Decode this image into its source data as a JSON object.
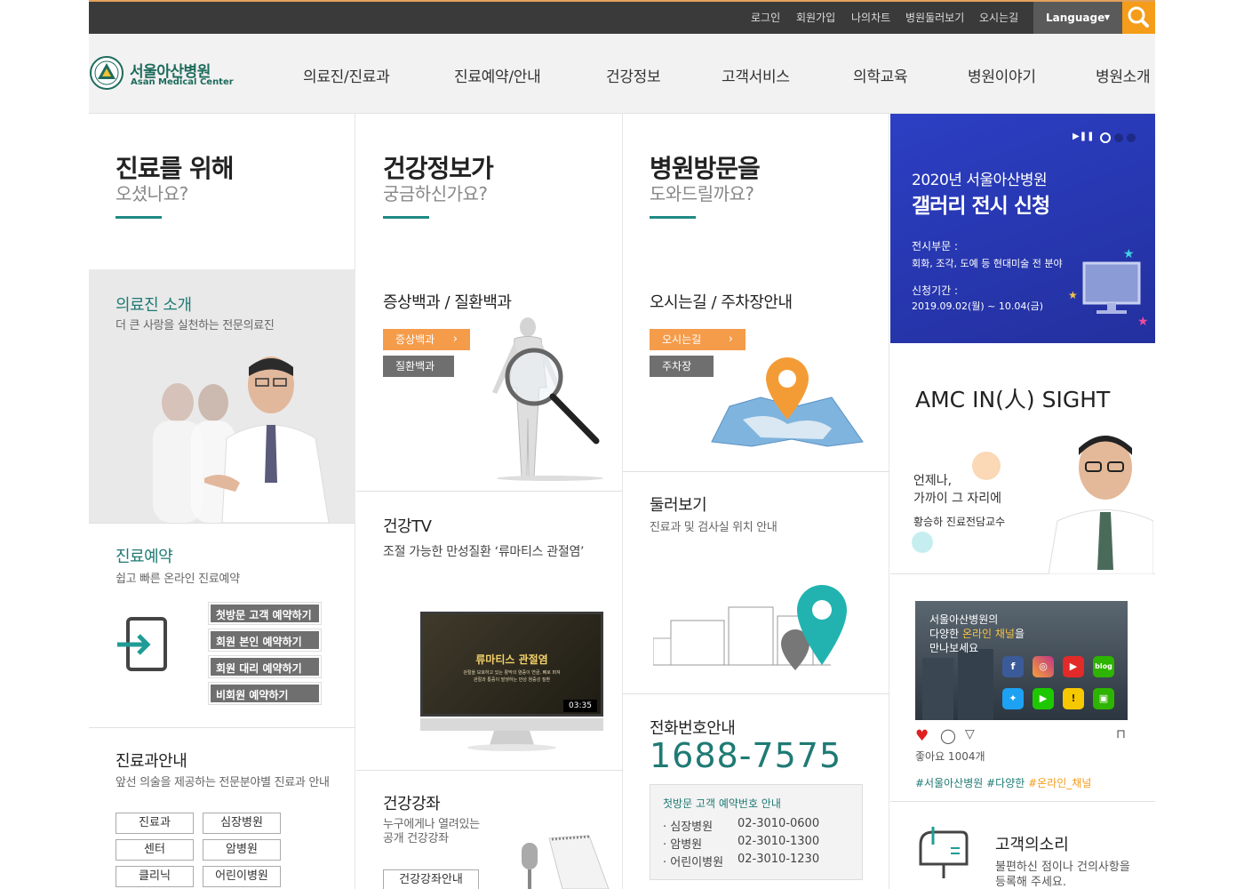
{
  "topbar": {
    "links": [
      "로그인",
      "회원가입",
      "나의차트",
      "병원둘러보기",
      "오시는길"
    ],
    "language": "Language"
  },
  "header": {
    "logo_kr": "서울아산병원",
    "logo_en": "Asan Medical Center",
    "nav": [
      "의료진/진료과",
      "진료예약/안내",
      "건강정보",
      "고객서비스",
      "의학교육",
      "병원이야기",
      "병원소개"
    ]
  },
  "col1": {
    "title": "진료를 위해",
    "subtitle": "오셨나요?",
    "doctors": {
      "title": "의료진 소개",
      "desc": "더 큰 사랑을 실천하는 전문의료진"
    },
    "reservation": {
      "title": "진료예약",
      "desc": "쉽고 빠른 온라인 진료예약",
      "buttons": [
        "첫방문 고객 예약하기",
        "회원 본인 예약하기",
        "회원 대리 예약하기",
        "비회원 예약하기"
      ]
    },
    "dept": {
      "title": "진료과안내",
      "desc": "앞선 의술을 제공하는 전문분야별 진료과 안내",
      "buttons": [
        "진료과",
        "심장병원",
        "센터",
        "암병원",
        "클리닉",
        "어린이병원"
      ]
    }
  },
  "col2": {
    "title": "건강정보가",
    "subtitle": "궁금하신가요?",
    "encyclopedia": {
      "title": "증상백과 / 질환백과",
      "btn1": "증상백과",
      "btn2": "질환백과"
    },
    "tv": {
      "title": "건강TV",
      "desc": "조절 가능한 만성질환 ‘류마티스 관절염’",
      "video_title": "류마티스 관절염",
      "video_text1": "관절을 보호하고 있는 활막의 염증이 연골, 뼈로 퍼져",
      "video_text2": "관절과 통증이 발생하는 만성 염증성 질환",
      "duration": "03:35"
    },
    "lecture": {
      "title": "건강강좌",
      "desc1": "누구에게나 열려있는",
      "desc2": "공개 건강강좌",
      "button": "건강강좌안내"
    }
  },
  "col3": {
    "title": "병원방문을",
    "subtitle": "도와드릴까요?",
    "directions": {
      "title": "오시는길 / 주차장안내",
      "btn1": "오시는길",
      "btn2": "주차장"
    },
    "tour": {
      "title": "둘러보기",
      "desc": "진료과 및 검사실 위치 안내"
    },
    "phone": {
      "title": "전화번호안내",
      "number": "1688-7575",
      "box_title": "첫방문 고객 예약번호 안내",
      "rows": [
        {
          "label": "· 심장병원",
          "number": "02-3010-0600"
        },
        {
          "label": "· 암병원",
          "number": "02-3010-1300"
        },
        {
          "label": "· 어린이병원",
          "number": "02-3010-1230"
        }
      ]
    }
  },
  "col4": {
    "banner": {
      "title_small": "2020년 서울아산병원",
      "title_big": "갤러리 전시 신청",
      "label1": "전시부문 :",
      "value1": "회화, 조각, 도예 등 현대미술 전 분야",
      "label2": "신청기간 :",
      "value2": "2019.09.02(월) ~ 10.04(금)"
    },
    "insight": {
      "title": "AMC IN(人) SIGHT",
      "quote1": "언제나,",
      "quote2": "가까이 그 자리에",
      "person": "황승하 진료전담교수"
    },
    "instagram": {
      "line1": "서울아산병원의",
      "line2_a": "다양한 ",
      "line2_b": "온라인 채널",
      "line2_c": "을",
      "line3": "만나보세요",
      "likes": "좋아요 1004개",
      "tags_a": "#서울아산병원 #다양한 ",
      "tags_b": "#온라인_채널",
      "blog": "blog"
    },
    "voice": {
      "title": "고객의소리",
      "desc1": "불편하신 점이나 건의사항을",
      "desc2": "등록해 주세요."
    }
  },
  "colors": {
    "accent": "#1f8a84",
    "orange": "#f59c1a",
    "banner_blue": "#2b3bb3"
  }
}
